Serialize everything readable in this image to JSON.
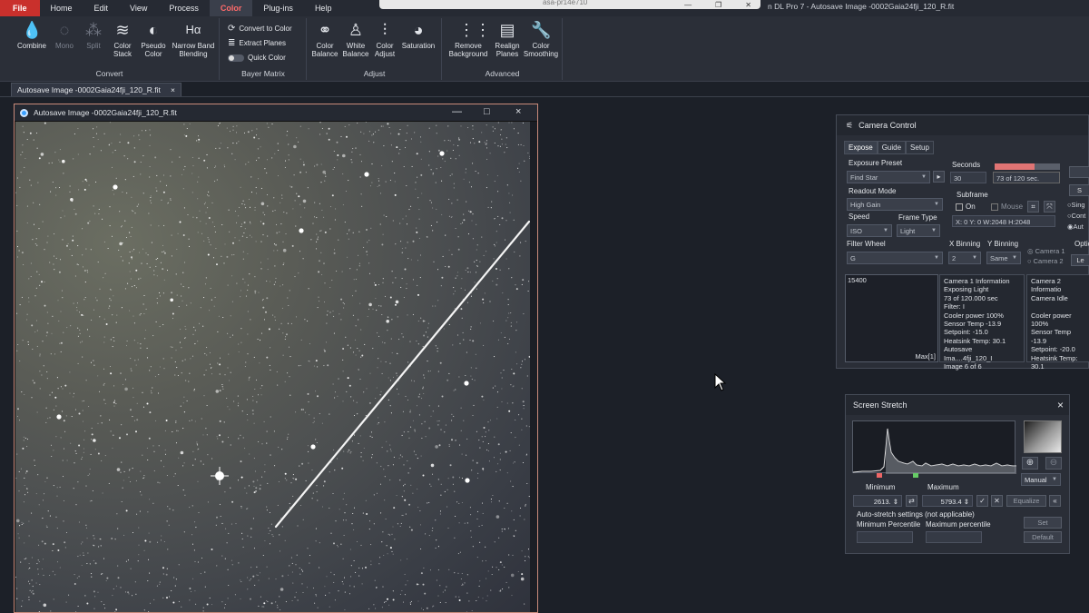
{
  "menubar": {
    "items": [
      "File",
      "Home",
      "Edit",
      "View",
      "Process",
      "Color",
      "Plug-ins",
      "Help"
    ],
    "active": "Color",
    "app_title": "n DL Pro 7 - Autosave Image -0002Gaia24fji_120_R.fit",
    "strip_text": "asa-pr14e710"
  },
  "ribbon": {
    "convert": {
      "label": "Convert",
      "tools": [
        {
          "label": "Combine",
          "icon": "drop-icon"
        },
        {
          "label": "Mono",
          "icon": "drop-outline-icon"
        },
        {
          "label": "Split",
          "icon": "split-drops-icon"
        },
        {
          "label": "Color Stack",
          "icon": "layers-icon"
        },
        {
          "label": "Pseudo Color",
          "icon": "half-drop-icon"
        },
        {
          "label": "Narrow Band Blending",
          "icon": "h-alpha-icon",
          "glyph": "Hα"
        }
      ]
    },
    "bayer": {
      "label": "Bayer Matrix",
      "convert_to_color": "Convert to Color",
      "extract_planes": "Extract Planes",
      "quick_color": "Quick Color"
    },
    "adjust": {
      "label": "Adjust",
      "tools": [
        {
          "label": "Color Balance"
        },
        {
          "label": "White Balance"
        },
        {
          "label": "Color Adjust"
        },
        {
          "label": "Saturation"
        }
      ]
    },
    "advanced": {
      "label": "Advanced",
      "tools": [
        {
          "label": "Remove Background"
        },
        {
          "label": "Realign Planes"
        },
        {
          "label": "Color Smoothing"
        }
      ]
    }
  },
  "doc_tab": {
    "label": "Autosave Image -0002Gaia24fji_120_R.fit",
    "close": "×"
  },
  "image_window": {
    "title": "Autosave Image -0002Gaia24fji_120_R.fit",
    "min": "—",
    "max": "□",
    "close": "×"
  },
  "camera": {
    "title": "Camera Control",
    "tabs": [
      "Expose",
      "Guide",
      "Setup"
    ],
    "exposure_preset_label": "Exposure Preset",
    "exposure_preset_value": "Find Star",
    "seconds_label": "Seconds",
    "seconds_value": "30",
    "progress_text": "73 of 120 sec.",
    "progress_fraction": 0.61,
    "readout_label": "Readout Mode",
    "readout_value": "High Gain",
    "subframe_label": "Subframe",
    "subframe_on": "On",
    "subframe_mouse": "Mouse",
    "subframe_coords": "X:   0 Y:   0 W:2048 H:2048",
    "speed_label": "Speed",
    "speed_value": "ISO",
    "frame_type_label": "Frame Type",
    "frame_type_value": "Light",
    "filter_wheel_label": "Filter Wheel",
    "filter_wheel_value": "G",
    "xbin_label": "X Binning",
    "xbin_value": "2",
    "ybin_label": "Y Binning",
    "ybin_value": "Same",
    "camera1": "Camera 1",
    "camera2": "Camera 2",
    "graph_value": "15400",
    "graph_max": "Max[1]",
    "info1": [
      "Camera 1 Information",
      "Exposing Light",
      "73 of 120.000 sec",
      "Filter: I",
      "Cooler power 100%",
      "Sensor Temp -13.9",
      "Setpoint: -15.0",
      "Heatsink Temp: 30.1",
      "Autosave Ima....4fji_120_I",
      "Image 6 of 6"
    ],
    "info2": [
      "Camera 2 Informatio",
      "Camera Idle",
      "",
      "Cooler power 100%",
      "Sensor Temp -13.9",
      "Setpoint: -20.0",
      "Heatsink Temp: 30.1"
    ],
    "right_cut": [
      "Sing",
      "Cont",
      "Aut",
      "Optio",
      "Le"
    ]
  },
  "stretch": {
    "title": "Screen Stretch",
    "close": "×",
    "mode": "Manual",
    "minimum_label": "Minimum",
    "maximum_label": "Maximum",
    "minimum_value": "2613.",
    "maximum_value": "5793.4",
    "equalize": "Equalize",
    "auto_label": "Auto-stretch settings (not applicable)",
    "min_pct_label": "Minimum Percentile",
    "max_pct_label": "Maximum percentile",
    "set": "Set",
    "default": "Default"
  }
}
